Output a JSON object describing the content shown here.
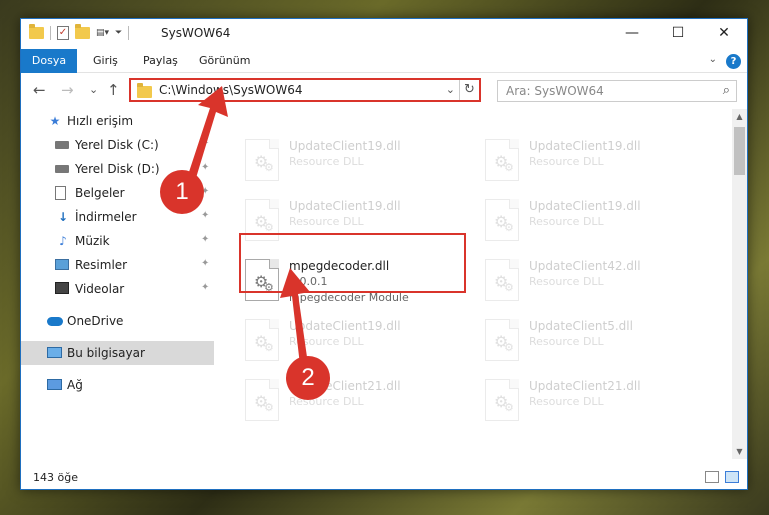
{
  "window": {
    "title": "SysWOW64",
    "minimize": "—",
    "maximize": "☐",
    "close": "✕"
  },
  "ribbon": {
    "tabs": [
      "Dosya",
      "Giriş",
      "Paylaş",
      "Görünüm"
    ],
    "help": "?"
  },
  "nav": {
    "back": "←",
    "forward": "→",
    "recent": "⌄",
    "up": "↑",
    "address": "C:\\Windows\\SysWOW64",
    "dropdown": "⌄",
    "refresh": "↻",
    "search_placeholder": "Ara: SysWOW64",
    "search_icon": "⌕"
  },
  "sidebar": {
    "items": [
      {
        "label": "Hızlı erişim",
        "icon": "star-icon"
      },
      {
        "label": "Yerel Disk (C:)",
        "icon": "disk-icon"
      },
      {
        "label": "Yerel Disk (D:)",
        "icon": "disk-icon"
      },
      {
        "label": "Belgeler",
        "icon": "document-icon"
      },
      {
        "label": "İndirmeler",
        "icon": "download-icon"
      },
      {
        "label": "Müzik",
        "icon": "music-icon"
      },
      {
        "label": "Resimler",
        "icon": "pictures-icon"
      },
      {
        "label": "Videolar",
        "icon": "videos-icon"
      },
      {
        "label": "OneDrive",
        "icon": "cloud-icon"
      },
      {
        "label": "Bu bilgisayar",
        "icon": "computer-icon"
      },
      {
        "label": "Ağ",
        "icon": "network-icon"
      }
    ],
    "pin_glyph": "✦"
  },
  "files": [
    {
      "name": "UpdateClient19.dll",
      "type": "Resource DLL"
    },
    {
      "name": "UpdateClient19.dll",
      "type": "Resource DLL"
    },
    {
      "name": "UpdateClient19.dll",
      "type": "Resource DLL"
    },
    {
      "name": "UpdateClient19.dll",
      "type": "Resource DLL"
    },
    {
      "name": "UpdateClient42.dll",
      "type": "Resource DLL"
    },
    {
      "name": "UpdateClient19.dll",
      "type": "Resource DLL"
    },
    {
      "name": "UpdateClient5.dll",
      "type": "Resource DLL"
    },
    {
      "name": "UpdateClient21.dll",
      "type": "Resource DLL"
    },
    {
      "name": "UpdateClient21.dll",
      "type": "Resource DLL"
    }
  ],
  "selected_file": {
    "name": "mpegdecoder.dll",
    "version": "1.0.0.1",
    "description": "mpegdecoder Module"
  },
  "status": {
    "count": "143 öğe"
  },
  "annotations": {
    "step1": "1",
    "step2": "2",
    "color": "#d9342b"
  }
}
